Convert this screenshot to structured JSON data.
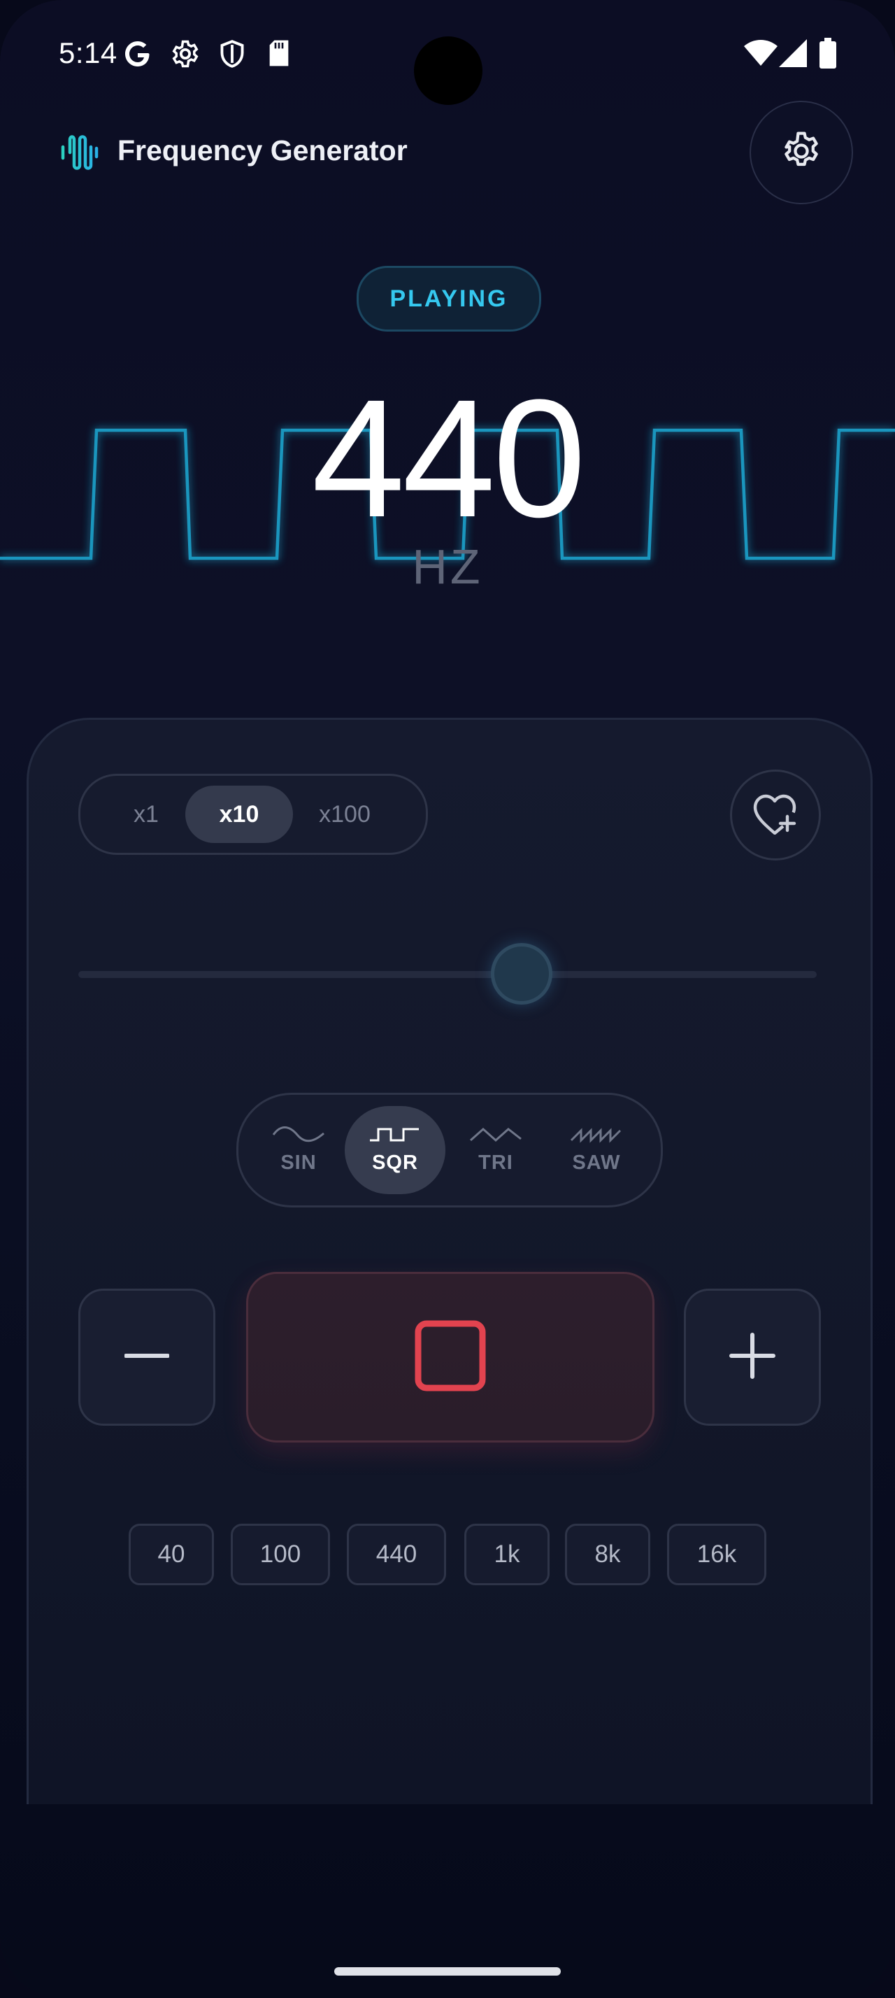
{
  "status_bar": {
    "time": "5:14",
    "left_icons": [
      "google-g-icon",
      "gear-icon",
      "shield-icon",
      "sd-card-icon"
    ],
    "right_icons": [
      "wifi-icon",
      "signal-icon",
      "battery-icon"
    ]
  },
  "header": {
    "title": "Frequency Generator",
    "logo_icon": "waveform-icon",
    "settings_icon": "gear-icon"
  },
  "playback": {
    "status_label": "PLAYING",
    "frequency": "440",
    "unit": "HZ",
    "waveform_display": "square"
  },
  "controls": {
    "multiplier": {
      "options": [
        "x1",
        "x10",
        "x100"
      ],
      "selected": "x10"
    },
    "favorite_icon": "heart-plus-icon",
    "slider_level": 0.6,
    "waveforms": {
      "options": [
        "SIN",
        "SQR",
        "TRI",
        "SAW"
      ],
      "selected": "SQR"
    },
    "decrement_icon": "minus-icon",
    "increment_icon": "plus-icon",
    "stop_icon": "stop-icon",
    "presets": [
      "40",
      "100",
      "440",
      "1k",
      "8k",
      "16k"
    ]
  },
  "colors": {
    "accent": "#35c8ef",
    "wave": "#1fa5cf",
    "stop": "#e2434f",
    "background": "#0c0d24"
  }
}
